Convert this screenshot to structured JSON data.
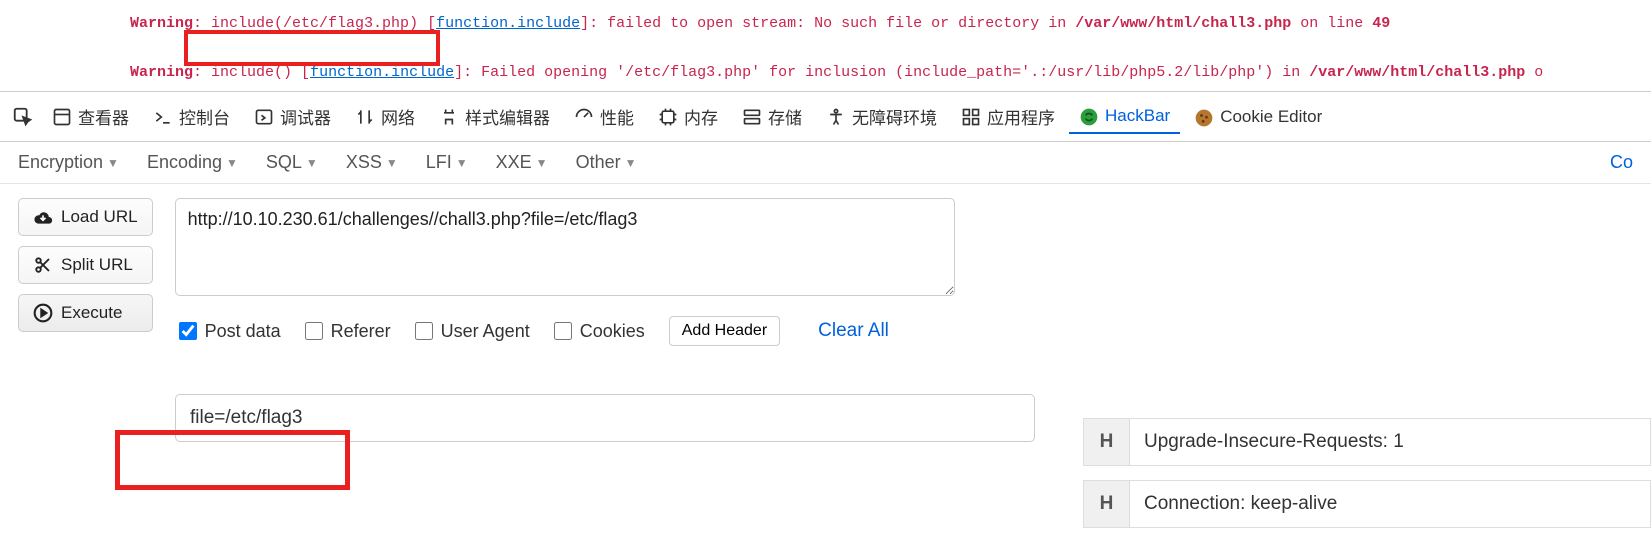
{
  "php_errors": {
    "line1": {
      "warning_label": "Warning",
      "func_text": "include(/etc/flag3.php)",
      "link_text": "function.include",
      "msg_tail": "]: failed to open stream: No such file or directory in ",
      "file": "/var/www/html/chall3.php",
      "on_line": " on line ",
      "lineno": "49"
    },
    "line2": {
      "warning_label": "Warning",
      "func_text": "include()",
      "link_text": "function.include",
      "msg_tail": "]: Failed opening '/etc/flag3.php' for inclusion (include_path='.:/usr/lib/php5.2/lib/php') in ",
      "file": "/var/www/html/chall3.php",
      "on_line_tail": " o"
    }
  },
  "devtools": {
    "tabs": {
      "inspector": "查看器",
      "console": "控制台",
      "debugger": "调试器",
      "network": "网络",
      "style": "样式编辑器",
      "performance": "性能",
      "memory": "内存",
      "storage": "存储",
      "accessibility": "无障碍环境",
      "application": "应用程序",
      "hackbar": "HackBar",
      "cookie_editor": "Cookie Editor"
    }
  },
  "hackbar": {
    "menus": {
      "encryption": "Encryption",
      "encoding": "Encoding",
      "sql": "SQL",
      "xss": "XSS",
      "lfi": "LFI",
      "xxe": "XXE",
      "other": "Other"
    },
    "right_link": "Co",
    "buttons": {
      "load_url": "Load URL",
      "split_url": "Split URL",
      "execute": "Execute"
    },
    "url_value": "http://10.10.230.61/challenges//chall3.php?file=/etc/flag3",
    "checks": {
      "post_data": "Post data",
      "referer": "Referer",
      "user_agent": "User Agent",
      "cookies": "Cookies"
    },
    "add_header": "Add Header",
    "clear_all": "Clear All",
    "body_value": "file=/etc/flag3"
  },
  "headers": {
    "h_label": "H",
    "row1": "Upgrade-Insecure-Requests: 1",
    "row2": "Connection: keep-alive"
  }
}
